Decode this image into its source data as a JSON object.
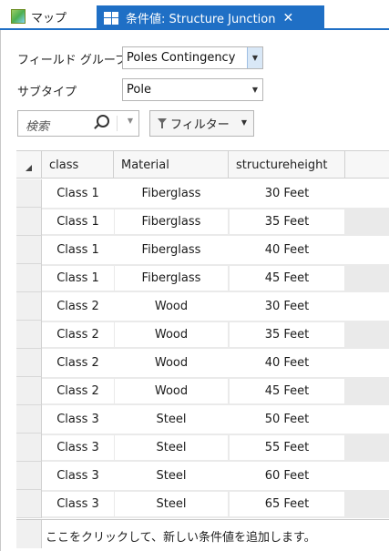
{
  "tabs": {
    "map_label": "マップ",
    "active_label": "条件値: Structure Junction",
    "close_glyph": "✕"
  },
  "form": {
    "field_group_label": "フィールド グループ",
    "field_group_value": "Poles Contingency",
    "subtype_label": "サブタイプ",
    "subtype_value": "Pole",
    "search_placeholder": "検索",
    "filter_label": "フィルター"
  },
  "grid": {
    "columns": [
      "class",
      "Material",
      "structureheight"
    ],
    "rows": [
      [
        "Class 1",
        "Fiberglass",
        "30 Feet"
      ],
      [
        "Class 1",
        "Fiberglass",
        "35 Feet"
      ],
      [
        "Class 1",
        "Fiberglass",
        "40 Feet"
      ],
      [
        "Class 1",
        "Fiberglass",
        "45 Feet"
      ],
      [
        "Class 2",
        "Wood",
        "30 Feet"
      ],
      [
        "Class 2",
        "Wood",
        "35 Feet"
      ],
      [
        "Class 2",
        "Wood",
        "40 Feet"
      ],
      [
        "Class 2",
        "Wood",
        "45 Feet"
      ],
      [
        "Class 3",
        "Steel",
        "50 Feet"
      ],
      [
        "Class 3",
        "Steel",
        "55 Feet"
      ],
      [
        "Class 3",
        "Steel",
        "60 Feet"
      ],
      [
        "Class 3",
        "Steel",
        "65 Feet"
      ]
    ],
    "add_row_hint": "ここをクリックして、新しい条件値を追加します。"
  },
  "colors": {
    "accent": "#1f6fc5",
    "row_alt": "#eaeaea"
  }
}
